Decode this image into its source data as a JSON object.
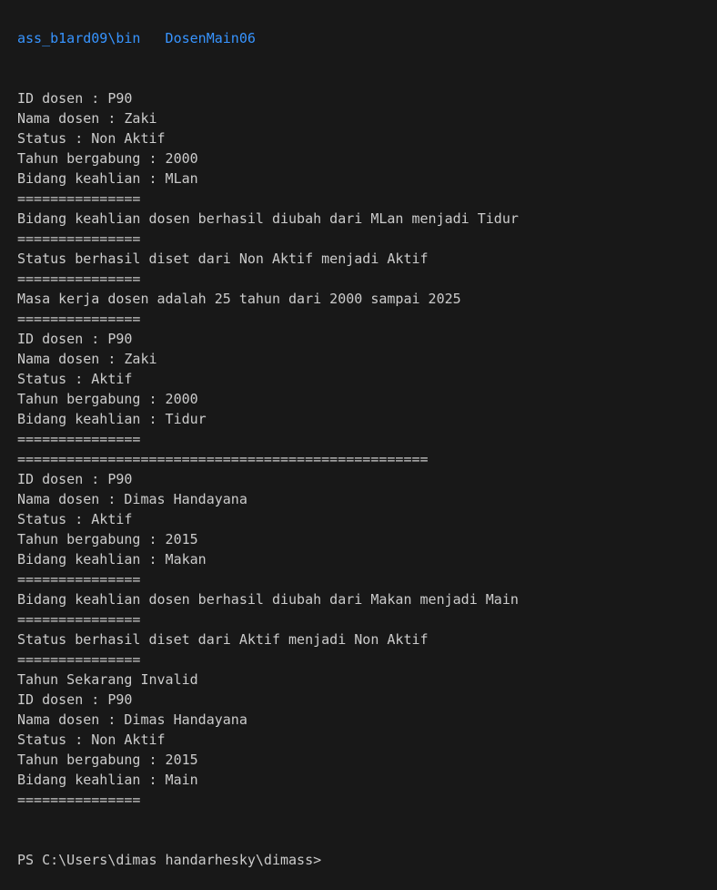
{
  "terminal": {
    "header_line": "ass_b1ard09\\bin   DosenMain06",
    "lines": [
      "ID dosen : P90",
      "Nama dosen : Zaki",
      "Status : Non Aktif",
      "Tahun bergabung : 2000",
      "Bidang keahlian : MLan",
      "===============",
      "Bidang keahlian dosen berhasil diubah dari MLan menjadi Tidur",
      "===============",
      "Status berhasil diset dari Non Aktif menjadi Aktif",
      "===============",
      "Masa kerja dosen adalah 25 tahun dari 2000 sampai 2025",
      "===============",
      "ID dosen : P90",
      "Nama dosen : Zaki",
      "Status : Aktif",
      "Tahun bergabung : 2000",
      "Bidang keahlian : Tidur",
      "===============",
      "==================================================",
      "ID dosen : P90",
      "Nama dosen : Dimas Handayana",
      "Status : Aktif",
      "Tahun bergabung : 2015",
      "Bidang keahlian : Makan",
      "===============",
      "Bidang keahlian dosen berhasil diubah dari Makan menjadi Main",
      "===============",
      "Status berhasil diset dari Aktif menjadi Non Aktif",
      "===============",
      "Tahun Sekarang Invalid",
      "ID dosen : P90",
      "Nama dosen : Dimas Handayana",
      "Status : Non Aktif",
      "Tahun bergabung : 2015",
      "Bidang keahlian : Main",
      "==============="
    ],
    "prompt": "PS C:\\Users\\dimas handarhesky\\dimass>"
  },
  "colors": {
    "background": "#181818",
    "text": "#cccccc",
    "path": "#3794ff"
  }
}
